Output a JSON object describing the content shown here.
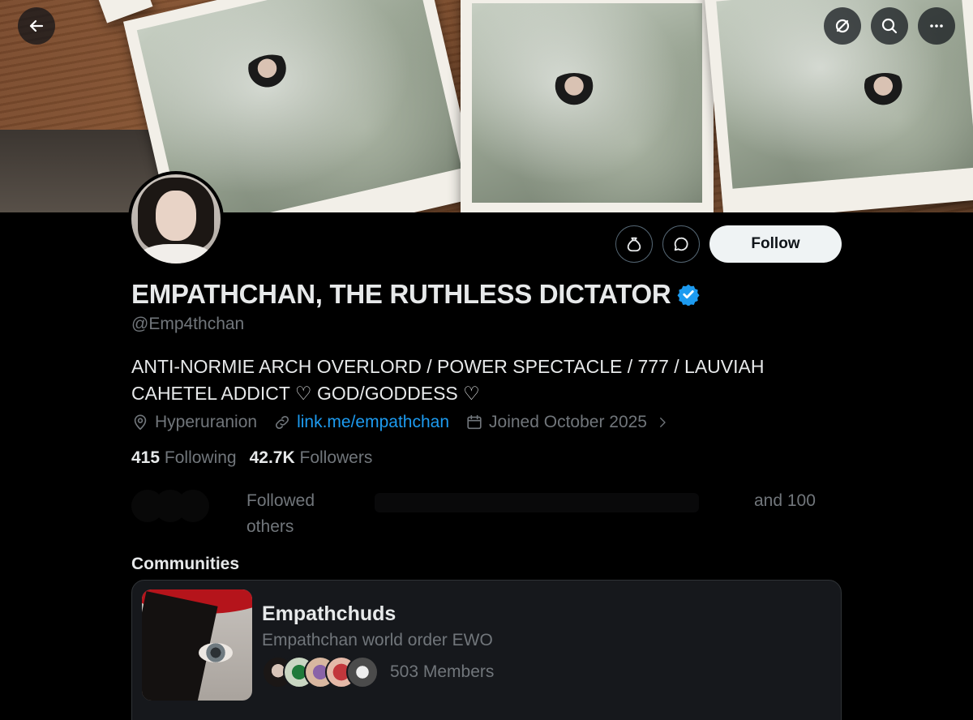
{
  "profile": {
    "display_name": "EMPATHCHAN, THE RUTHLESS DICTATOR",
    "handle": "@Emp4thchan",
    "bio": "ANTI-NORMIE ARCH OVERLORD / POWER SPECTACLE / 777 / LAUVIAH CAHETEL ADDICT ♡ GOD/GODDESS ♡",
    "location": "Hyperuranion",
    "link": "link.me/empathchan",
    "joined": "Joined October 2025",
    "following_count": "415",
    "following_label": "Following",
    "followers_count": "42.7K",
    "followers_label": "Followers",
    "verified_color": "#1d9bf0"
  },
  "actions": {
    "follow_label": "Follow"
  },
  "followed_by": {
    "prefix": "Followed",
    "suffix_a": "and 100",
    "suffix_b": "others"
  },
  "communities": {
    "title": "Communities",
    "items": [
      {
        "name": "Empathchuds",
        "description": "Empathchan world order EWO",
        "members": "503 Members"
      }
    ]
  },
  "icons": {
    "back": "arrow-left-icon",
    "grok": "grok-icon",
    "search": "search-icon",
    "more": "more-icon",
    "tip": "money-bag-icon",
    "message": "message-icon",
    "location": "location-pin-icon",
    "link": "link-icon",
    "calendar": "calendar-icon"
  },
  "colors": {
    "background": "#000000",
    "text_primary": "#e7e9ea",
    "text_secondary": "#71767b",
    "accent": "#1d9bf0"
  }
}
